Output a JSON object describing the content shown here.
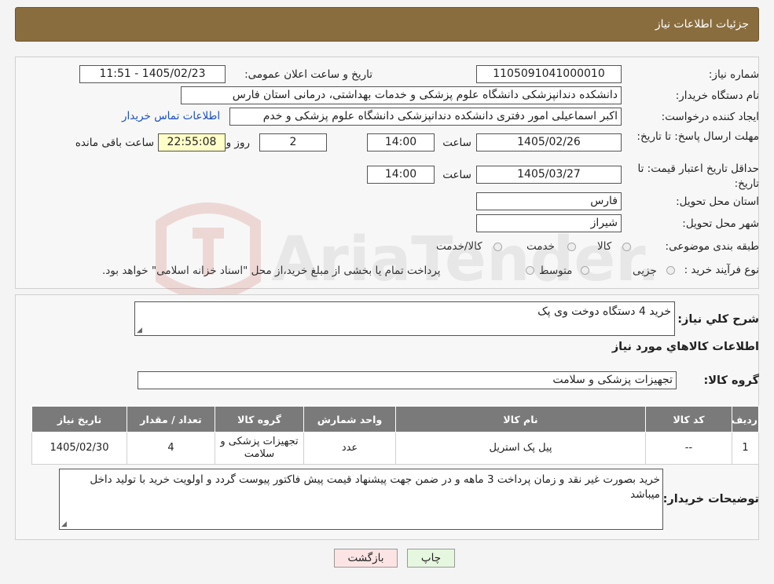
{
  "header": {
    "title": "جزئیات اطلاعات نیاز"
  },
  "fields": {
    "need_number_label": "شماره نیاز:",
    "need_number": "1105091041000010",
    "announce_label": "تاریخ و ساعت اعلان عمومی:",
    "announce_value": "1405/02/23 - 11:51",
    "buyer_org_label": "نام دستگاه خریدار:",
    "buyer_org": "دانشکده دندانپزشکی دانشگاه علوم پزشکی و خدمات بهداشتی، درمانی استان فارس",
    "creator_label": "ایجاد کننده درخواست:",
    "creator": "اکبر  اسماعیلی امور دفتری دانشکده دندانپزشکی دانشگاه علوم پزشکی و خدم",
    "contact_link": "اطلاعات تماس خریدار",
    "deadline_label": "مهلت ارسال پاسخ: تا تاریخ:",
    "deadline_date": "1405/02/26",
    "time_label": "ساعت",
    "deadline_time": "14:00",
    "days_value": "2",
    "days_label": "روز و",
    "remaining_time": "22:55:08",
    "remaining_label": "ساعت باقی مانده",
    "validity_label": "حداقل تاریخ اعتبار قیمت: تا تاریخ:",
    "validity_date": "1405/03/27",
    "validity_time": "14:00",
    "province_label": "استان محل تحویل:",
    "province": "فارس",
    "city_label": "شهر محل تحویل:",
    "city": "شیراز",
    "category_label": "طبقه بندی موضوعی:",
    "category_options": [
      "کالا",
      "خدمت",
      "کالا/خدمت"
    ],
    "process_label": "نوع فرآیند خرید :",
    "process_options": [
      "جزیی",
      "متوسط"
    ],
    "process_note": "پرداخت تمام یا بخشی از مبلغ خرید،از محل \"اسناد خزانه اسلامی\" خواهد بود."
  },
  "summary": {
    "label": "شرح کلي نياز:",
    "value": "خرید 4 دستگاه دوخت وی پک"
  },
  "goods": {
    "section_title": "اطلاعات کالاهاي مورد نياز",
    "group_label": "گروه کالا:",
    "group_value": "تجهیزات پزشکی و سلامت",
    "columns": [
      "رديف",
      "کد کالا",
      "نام کالا",
      "واحد شمارش",
      "گروه کالا",
      "تعداد / مقدار",
      "تاریخ نیاز"
    ],
    "rows": [
      [
        "1",
        "--",
        "پیل پک استریل",
        "عدد",
        "تجهیزات پزشکی و سلامت",
        "4",
        "1405/02/30"
      ]
    ]
  },
  "buyer_notes": {
    "label": "توضيحات خريدار:",
    "value": "خرید بصورت غیر نقد و زمان پرداخت 3 ماهه و در ضمن جهت پیشنهاد قیمت پیش فاکتور پیوست گردد و اولویت خرید با تولید داخل میباشد"
  },
  "buttons": {
    "print": "چاپ",
    "back": "بازگشت"
  },
  "watermark": "AriaTender.neT",
  "colors": {
    "header_bg": "#8a6d3e",
    "table_head": "#7a7a7a",
    "link": "#1d4fc4"
  }
}
